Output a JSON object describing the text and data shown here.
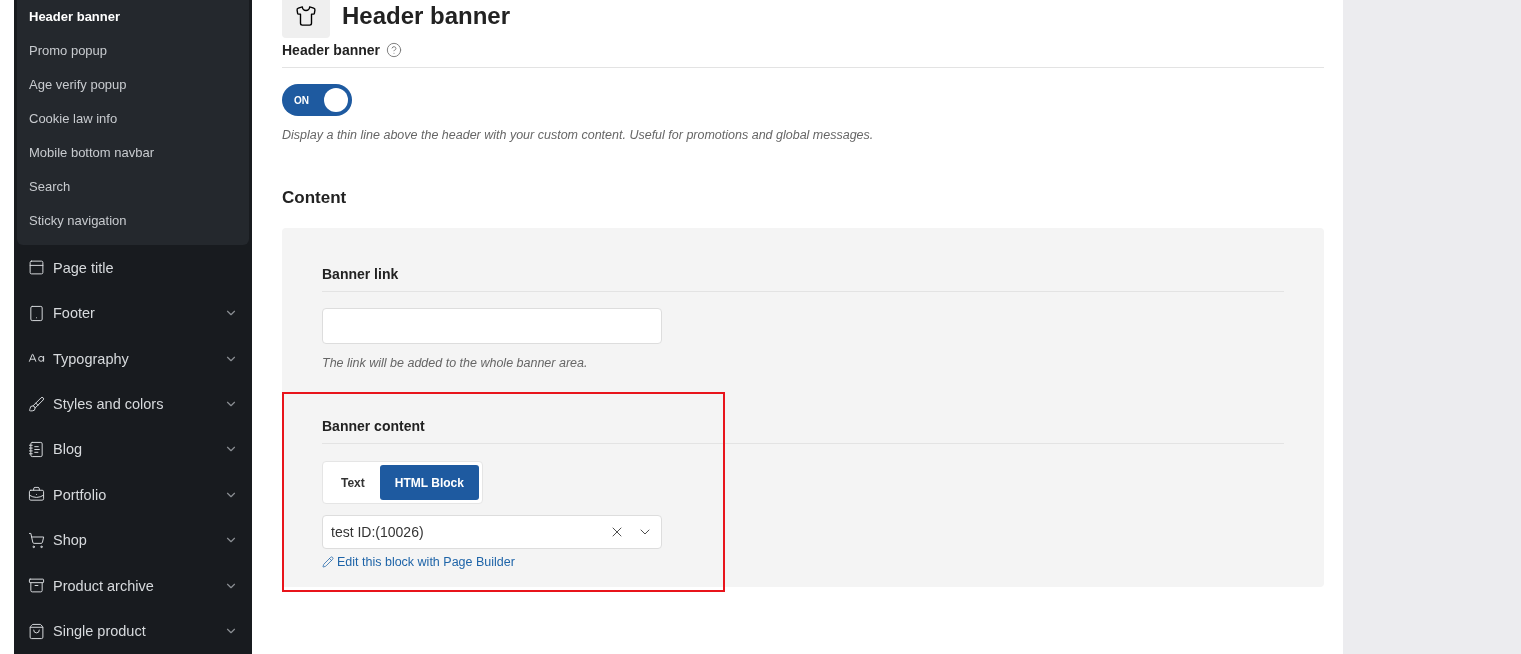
{
  "sidebar": {
    "submenu": [
      {
        "label": "Header banner",
        "selected": true
      },
      {
        "label": "Promo popup",
        "selected": false
      },
      {
        "label": "Age verify popup",
        "selected": false
      },
      {
        "label": "Cookie law info",
        "selected": false
      },
      {
        "label": "Mobile bottom navbar",
        "selected": false
      },
      {
        "label": "Search",
        "selected": false
      },
      {
        "label": "Sticky navigation",
        "selected": false
      }
    ],
    "items": [
      {
        "label": "Page title",
        "expandable": false
      },
      {
        "label": "Footer",
        "expandable": true
      },
      {
        "label": "Typography",
        "expandable": true
      },
      {
        "label": "Styles and colors",
        "expandable": true
      },
      {
        "label": "Blog",
        "expandable": true
      },
      {
        "label": "Portfolio",
        "expandable": true
      },
      {
        "label": "Shop",
        "expandable": true
      },
      {
        "label": "Product archive",
        "expandable": true
      },
      {
        "label": "Single product",
        "expandable": true
      }
    ]
  },
  "page": {
    "title": "Header banner"
  },
  "toggle_field": {
    "label": "Header banner",
    "on": true,
    "on_label": "ON",
    "description": "Display a thin line above the header with your custom content. Useful for promotions and global messages."
  },
  "section": {
    "title": "Content"
  },
  "banner_link": {
    "label": "Banner link",
    "description": "The link will be added to the whole banner area."
  },
  "banner_content": {
    "label": "Banner content",
    "highlighted": true,
    "tabs": [
      {
        "label": "Text",
        "selected": false
      },
      {
        "label": "HTML Block",
        "selected": true
      }
    ],
    "select_value": "test ID:(10026)",
    "edit_link": "Edit this block with Page Builder"
  }
}
